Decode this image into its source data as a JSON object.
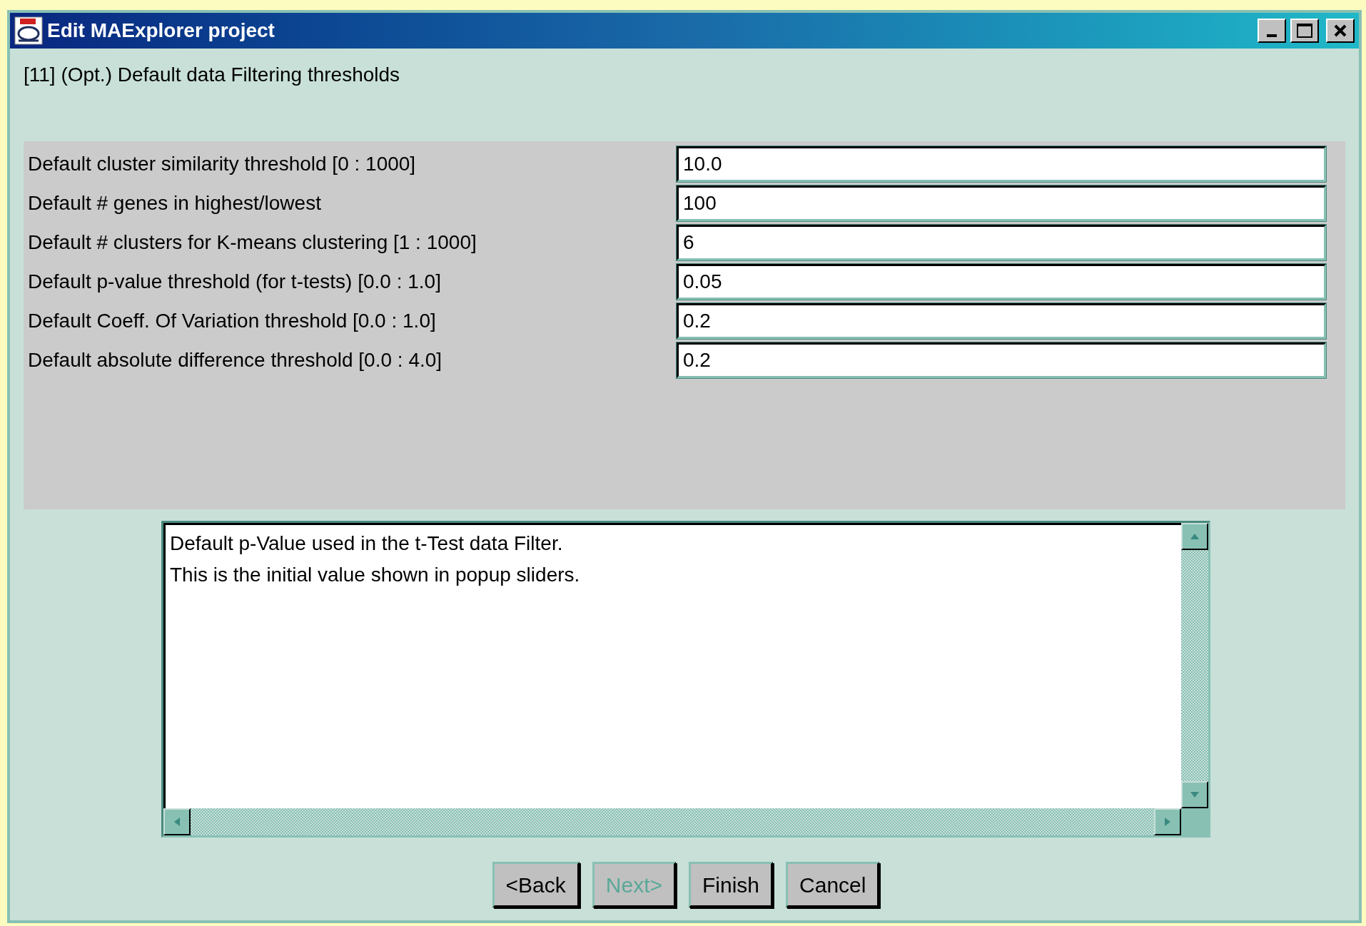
{
  "window": {
    "title": "Edit MAExplorer project"
  },
  "heading": "[11] (Opt.) Default data Filtering thresholds",
  "fields": [
    {
      "label": "Default cluster similarity threshold [0 : 1000]",
      "value": "10.0"
    },
    {
      "label": "Default # genes in highest/lowest",
      "value": "100"
    },
    {
      "label": "Default # clusters for K-means clustering [1 : 1000]",
      "value": "6"
    },
    {
      "label": "Default p-value threshold (for t-tests) [0.0 : 1.0]",
      "value": "0.05"
    },
    {
      "label": "Default Coeff. Of Variation threshold [0.0 : 1.0]",
      "value": "0.2"
    },
    {
      "label": "Default absolute difference threshold [0.0 : 4.0]",
      "value": "0.2"
    }
  ],
  "help_text": {
    "lines": [
      "Default p-Value used in the t-Test data Filter.",
      "This is the initial value shown in popup sliders."
    ]
  },
  "buttons": [
    {
      "label": "<Back",
      "disabled": false
    },
    {
      "label": "Next>",
      "disabled": true
    },
    {
      "label": "Finish",
      "disabled": false
    },
    {
      "label": "Cancel",
      "disabled": false
    }
  ]
}
